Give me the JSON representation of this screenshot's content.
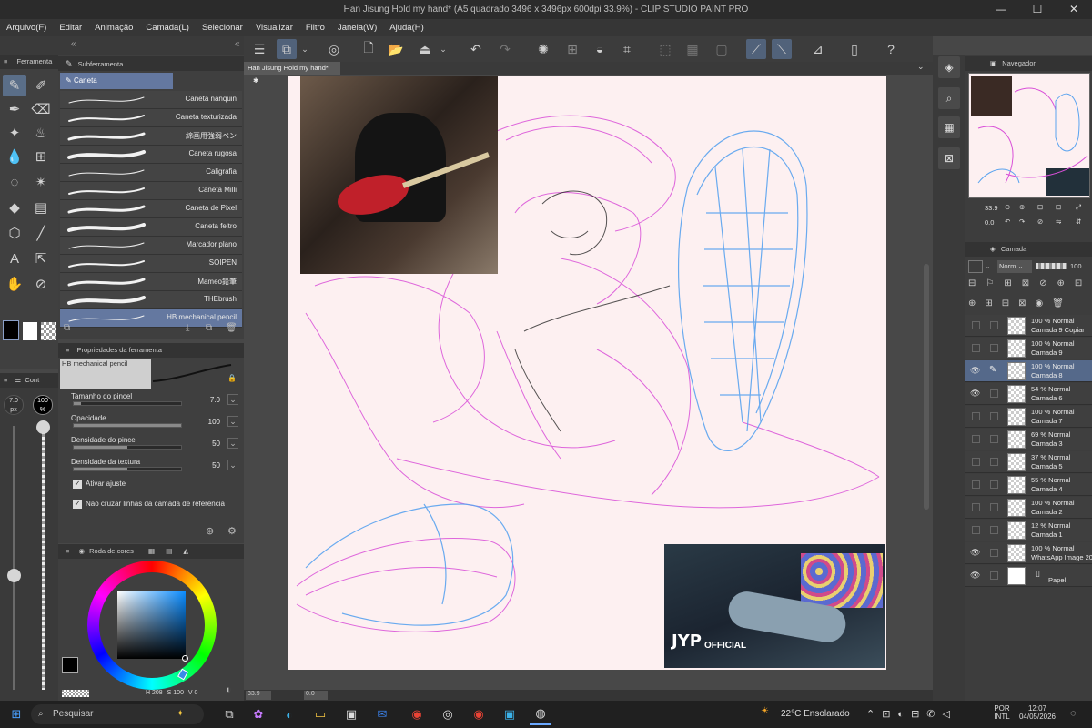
{
  "window": {
    "title": "Han Jisung Hold my hand* (A5 quadrado 3496 x 3496px 600dpi 33.9%) - CLIP STUDIO PAINT PRO",
    "minimize": "—",
    "maximize": "☐",
    "close": "✕"
  },
  "menu": [
    "Arquivo(F)",
    "Editar",
    "Animação",
    "Camada(L)",
    "Selecionar",
    "Visualizar",
    "Filtro",
    "Janela(W)",
    "Ajuda(H)"
  ],
  "document": {
    "tab_label": "Han Jisung Hold my hand*"
  },
  "tool_panel": {
    "tab": "Ferramenta",
    "sub_tab": "Subferramenta",
    "current_group": "Caneta"
  },
  "brushes": [
    {
      "name": "Caneta nanquin"
    },
    {
      "name": "Caneta texturizada"
    },
    {
      "name": "綿画用強弱ペン"
    },
    {
      "name": "Caneta rugosa"
    },
    {
      "name": "Caligrafia"
    },
    {
      "name": "Caneta Milli"
    },
    {
      "name": "Caneta de Pixel"
    },
    {
      "name": "Caneta feltro"
    },
    {
      "name": "Marcador plano"
    },
    {
      "name": "SOIPEN"
    },
    {
      "name": "Mameo鉛筆"
    },
    {
      "name": "THEbrush"
    },
    {
      "name": "HB mechanical pencil"
    }
  ],
  "tool_property": {
    "header": "Propriedades da ferramenta",
    "brush_name": "HB mechanical pencil",
    "params": [
      {
        "label": "Tamanho do pincel",
        "value": "7.0",
        "level": 0.07
      },
      {
        "label": "Opacidade",
        "value": "100",
        "level": 1.0
      },
      {
        "label": "Densidade do pincel",
        "value": "50",
        "level": 0.5
      },
      {
        "label": "Densidade da textura",
        "value": "50",
        "level": 0.5
      }
    ],
    "checkboxes": [
      "Ativar ajuste",
      "Não cruzar linhas da camada de referência"
    ]
  },
  "brush_size_panel": {
    "tab": "Cont",
    "size": "7.0",
    "size_unit": "px",
    "opacity": "100",
    "opacity_unit": "%"
  },
  "color_panel": {
    "tab": "Roda de cores",
    "readout": {
      "h_label": "H",
      "h": "208",
      "s_label": "S",
      "s": "100",
      "v_label": "V",
      "v": "0"
    }
  },
  "navigator": {
    "tab": "Navegador",
    "zoom": "33.9",
    "angle": "0.0"
  },
  "layer_panel": {
    "tab": "Camada",
    "blend_mode": "Norm",
    "opacity": "100",
    "layers": [
      {
        "opacity_mode": "100 % Normal",
        "name": "Camada 9 Copiar",
        "visible": false
      },
      {
        "opacity_mode": "100 % Normal",
        "name": "Camada 9",
        "visible": false
      },
      {
        "opacity_mode": "100 % Normal",
        "name": "Camada 8",
        "visible": true,
        "selected": true
      },
      {
        "opacity_mode": "54 % Normal",
        "name": "Camada 6",
        "visible": true
      },
      {
        "opacity_mode": "100 % Normal",
        "name": "Camada 7",
        "visible": false
      },
      {
        "opacity_mode": "69 % Normal",
        "name": "Camada 3",
        "visible": false
      },
      {
        "opacity_mode": "37 % Normal",
        "name": "Camada 5",
        "visible": false
      },
      {
        "opacity_mode": "55 % Normal",
        "name": "Camada 4",
        "visible": false
      },
      {
        "opacity_mode": "100 % Normal",
        "name": "Camada 2",
        "visible": false
      },
      {
        "opacity_mode": "12 % Normal",
        "name": "Camada 1",
        "visible": false
      },
      {
        "opacity_mode": "100 % Normal",
        "name": "WhatsApp Image 202",
        "visible": true
      },
      {
        "opacity_mode": "",
        "name": "Papel",
        "visible": true
      }
    ]
  },
  "canvas_status": {
    "zoom": "33.9",
    "angle": "0.0"
  },
  "reference_photo": {
    "watermark_logo": "JYP",
    "watermark_text": "OFFICIAL"
  },
  "taskbar": {
    "search_placeholder": "Pesquisar",
    "weather": "22°C Ensolarado",
    "lang_line1": "POR",
    "lang_line2": "INTL",
    "time": "12:07",
    "date": "04/05/2026"
  },
  "colors": {
    "accent": "#6478a0",
    "panel": "#3f3f3f",
    "canvas_paper": "#fdf0f1"
  }
}
